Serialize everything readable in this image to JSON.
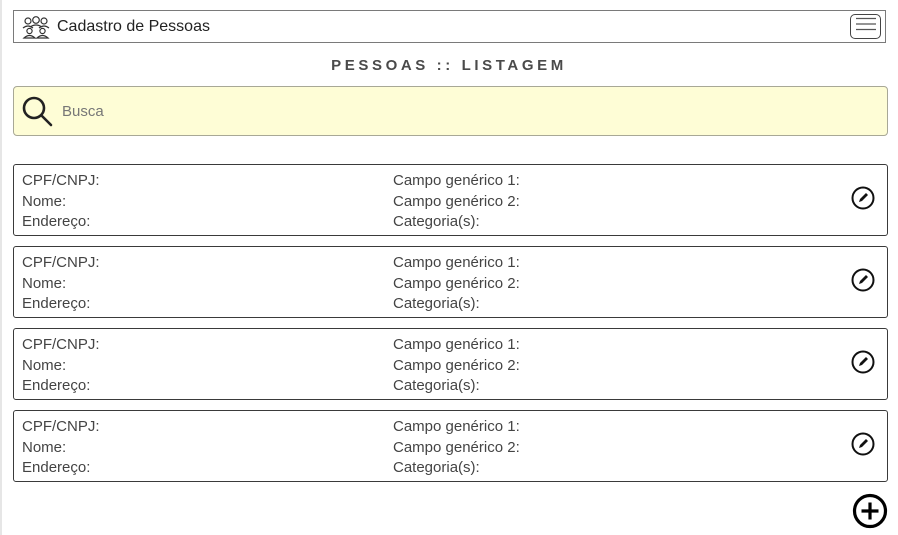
{
  "header": {
    "title": "Cadastro de Pessoas",
    "logo_icon": "people-group-icon",
    "menu_icon": "hamburger-menu-icon"
  },
  "page": {
    "heading": "PESSOAS :: LISTAGEM"
  },
  "search": {
    "placeholder": "Busca",
    "value": "",
    "icon": "search-icon",
    "background": "#fefdd6"
  },
  "records": [
    {
      "cpf_label": "CPF/CNPJ:",
      "nome_label": "Nome:",
      "endereco_label": "Endereço:",
      "campo1_label": "Campo genérico 1:",
      "campo2_label": "Campo genérico 2:",
      "categorias_label": "Categoria(s):",
      "edit_icon": "pencil-circle-icon"
    },
    {
      "cpf_label": "CPF/CNPJ:",
      "nome_label": "Nome:",
      "endereco_label": "Endereço:",
      "campo1_label": "Campo genérico 1:",
      "campo2_label": "Campo genérico 2:",
      "categorias_label": "Categoria(s):",
      "edit_icon": "pencil-circle-icon"
    },
    {
      "cpf_label": "CPF/CNPJ:",
      "nome_label": "Nome:",
      "endereco_label": "Endereço:",
      "campo1_label": "Campo genérico 1:",
      "campo2_label": "Campo genérico 2:",
      "categorias_label": "Categoria(s):",
      "edit_icon": "pencil-circle-icon"
    },
    {
      "cpf_label": "CPF/CNPJ:",
      "nome_label": "Nome:",
      "endereco_label": "Endereço:",
      "campo1_label": "Campo genérico 1:",
      "campo2_label": "Campo genérico 2:",
      "categorias_label": "Categoria(s):",
      "edit_icon": "pencil-circle-icon"
    }
  ],
  "actions": {
    "add_icon": "plus-circle-icon"
  }
}
